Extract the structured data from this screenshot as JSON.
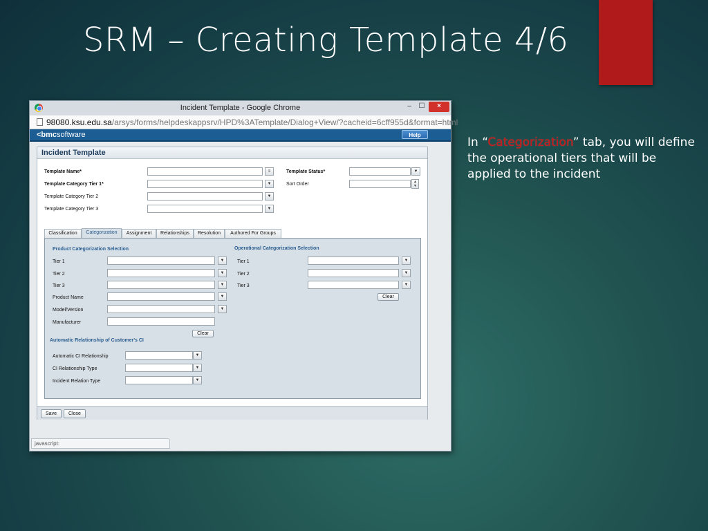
{
  "slide": {
    "title": "SRM – Creating Template 4/6",
    "side_text": {
      "prefix": "In “",
      "highlight": "Categorization",
      "suffix": "” tab, you will define the operational tiers that will be applied to the incident"
    }
  },
  "browser": {
    "window_title": "Incident Template - Google Chrome",
    "min_label": "–",
    "max_label": "☐",
    "close_label": "×",
    "url_host": "98080.ksu.edu.sa",
    "url_path": "/arsys/forms/helpdeskappsrv/HPD%3ATemplate/Dialog+View/?cacheid=6cff955d&format=html",
    "status_text": "javascript:"
  },
  "app": {
    "logo_prefix": "<bmc",
    "logo_suffix": "software",
    "help_label": "Help"
  },
  "form": {
    "title": "Incident Template",
    "fields_left": [
      {
        "label": "Template Name*"
      },
      {
        "label": "Template Category Tier 1*"
      },
      {
        "label": "Template Category Tier 2"
      },
      {
        "label": "Template Category Tier 3"
      }
    ],
    "template_status_label": "Template Status*",
    "sort_order_label": "Sort Order",
    "tabs": [
      "Classification",
      "Categorization",
      "Assignment",
      "Relationships",
      "Resolution",
      "Authored For Groups"
    ],
    "active_tab": "Categorization",
    "product_section": {
      "title": "Product Categorization Selection",
      "fields": [
        "Tier 1",
        "Tier 2",
        "Tier 3",
        "Product Name",
        "Model/Version",
        "Manufacturer"
      ],
      "clear_label": "Clear"
    },
    "operational_section": {
      "title": "Operational Categorization Selection",
      "fields": [
        "Tier 1",
        "Tier 2",
        "Tier 3"
      ],
      "clear_label": "Clear"
    },
    "ci_section": {
      "title": "Automatic Relationship of Customer's CI",
      "fields": [
        "Automatic CI Relationship",
        "CI Relationship Type",
        "Incident Relation Type"
      ]
    },
    "save_label": "Save",
    "close_label": "Close"
  }
}
